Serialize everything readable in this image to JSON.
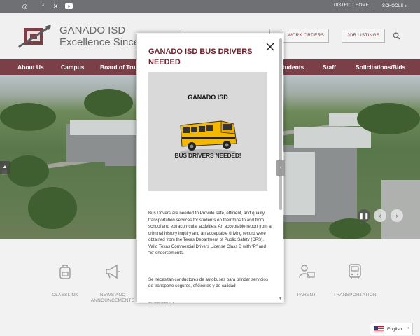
{
  "topbar": {
    "social_icons": [
      "instagram-icon",
      "facebook-icon",
      "x-icon",
      "youtube-icon"
    ],
    "district_home": "DISTRICT HOME",
    "schools": "SCHOOLS"
  },
  "header": {
    "name_line1": "GANADO ISD",
    "name_line2": "Excellence Since 1",
    "work_orders": "WORK ORDERS",
    "job_listings": "JOB LISTINGS"
  },
  "nav": [
    "About Us",
    "Campus",
    "Board of Trus",
    "Students",
    "Staff",
    "Solicitations/Bids"
  ],
  "quick_links": [
    {
      "icon": "backpack-icon",
      "label": "CLASSLINK"
    },
    {
      "icon": "megaphone-icon",
      "label": "NEWS AND ANNOUNCEMENTS"
    },
    {
      "icon": "calendar-icon",
      "label": "CALENDAR"
    },
    {
      "icon": "parent-icon",
      "label": "PARENT"
    },
    {
      "icon": "bus-icon",
      "label": "TRANSPORTATION"
    }
  ],
  "language": {
    "label": "English"
  },
  "modal": {
    "title": "GANADO ISD BUS DRIVERS NEEDED",
    "flyer_heading": "GANADO ISD",
    "flyer_subheading": "BUS DRIVERS NEEDED!",
    "body_en": "Bus Drivers are needed to Provide safe, efficient, and quality transportation services for students on their trips to and from school and extracurricular activities. An acceptable report from a criminal history inquiry and an acceptable driving record were obtained from the Texas Department of Public Safety (DPS). Valid Texas Commercial Drivers License Class B with “P” and “S” endorsements.",
    "body_es": "Se necesitan conductores de autobuses para brindar servicios de transporte seguros, eficientes y de calidad"
  },
  "colors": {
    "brand": "#7a3f47",
    "title": "#6e1f2c",
    "topbar": "#6e7074"
  }
}
